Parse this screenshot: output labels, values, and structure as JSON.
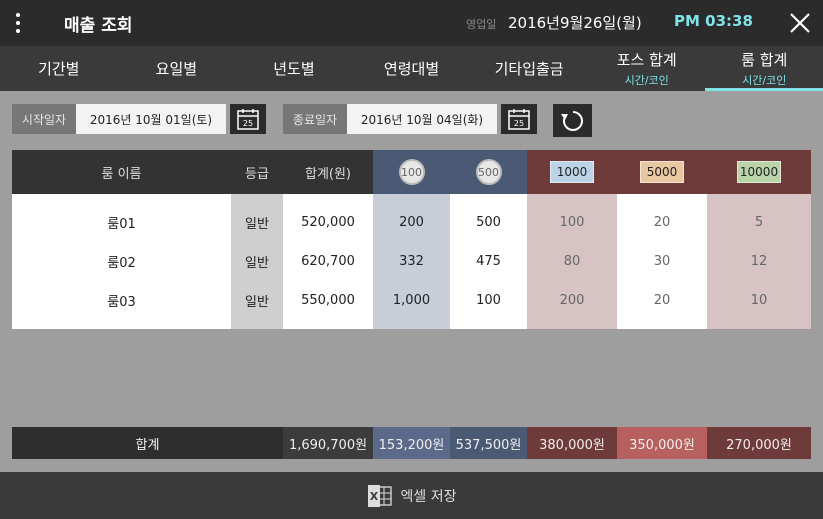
{
  "header": {
    "title": "매출 조회",
    "biz_label": "영업일",
    "biz_date": "2016년9월26일(월)",
    "time": "PM 03:38"
  },
  "tabs": [
    {
      "label": "기간별",
      "sub": ""
    },
    {
      "label": "요일별",
      "sub": ""
    },
    {
      "label": "년도별",
      "sub": ""
    },
    {
      "label": "연령대별",
      "sub": ""
    },
    {
      "label": "기타입출금",
      "sub": ""
    },
    {
      "label": "포스 합계",
      "sub": "시간/코인"
    },
    {
      "label": "룸 합계",
      "sub": "시간/코인"
    }
  ],
  "active_tab": 6,
  "filter": {
    "start_label": "시작일자",
    "start_value": "2016년 10월 01일(토)",
    "end_label": "종료일자",
    "end_value": "2016년 10월 04일(화)",
    "calendar_day": "25"
  },
  "table": {
    "headers": {
      "name": "룸 이름",
      "grade": "등급",
      "total": "합계(원)",
      "coin100": "100",
      "coin500": "500",
      "bill1000": "1000",
      "bill5000": "5000",
      "bill10000": "10000"
    },
    "rows": [
      {
        "name": "룸01",
        "grade": "일반",
        "total": "520,000",
        "c100": "200",
        "c500": "500",
        "b1000": "100",
        "b5000": "20",
        "b10000": "5"
      },
      {
        "name": "룸02",
        "grade": "일반",
        "total": "620,700",
        "c100": "332",
        "c500": "475",
        "b1000": "80",
        "b5000": "30",
        "b10000": "12"
      },
      {
        "name": "룸03",
        "grade": "일반",
        "total": "550,000",
        "c100": "1,000",
        "c500": "100",
        "b1000": "200",
        "b5000": "20",
        "b10000": "10"
      }
    ],
    "summary": {
      "label": "합계",
      "total": "1,690,700원",
      "c100": "153,200원",
      "c500": "537,500원",
      "b1000": "380,000원",
      "b5000": "350,000원",
      "b10000": "270,000원"
    }
  },
  "footer": {
    "excel_label": "엑셀 저장"
  },
  "colors": {
    "accent": "#7fe3e8",
    "header_bg": "#2b2b2b"
  }
}
